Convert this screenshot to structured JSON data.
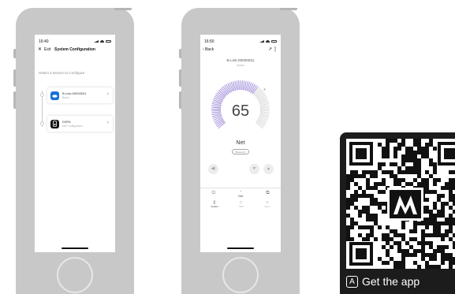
{
  "phone1": {
    "time": "16:40",
    "exit_label": "Exit",
    "title": "System Configuration",
    "prompt": "Select a Device to Configure",
    "devices": [
      {
        "name": "B-Link-00000031",
        "sub": "Brand",
        "icon": "cloud-device-icon",
        "color": "#1b6fd8"
      },
      {
        "name": "DSP8",
        "sub": "DSP configuration",
        "icon": "speaker-device-icon",
        "color": "#111111"
      }
    ]
  },
  "phone2": {
    "time": "16:50",
    "back_label": "Back",
    "device_name": "B-Link-00000031",
    "device_sub": "Brand",
    "volume": 65,
    "volume_fraction": 0.65,
    "source": "Net",
    "source_button": "Bluetooth",
    "tab_center": "Net",
    "nav_items": [
      {
        "label": "Control",
        "icon": "speaker-icon",
        "active": true
      },
      {
        "label": "SRC",
        "icon": "play-icon",
        "active": false
      },
      {
        "label": "Menu",
        "icon": "menu-icon",
        "active": false
      }
    ],
    "accent": "#9b87d6"
  },
  "qr_card": {
    "cta": "Get the app"
  }
}
